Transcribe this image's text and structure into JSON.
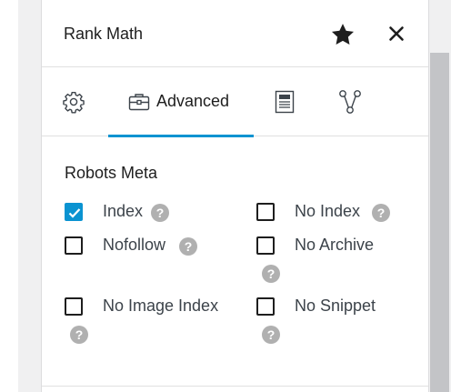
{
  "panel": {
    "title": "Rank Math"
  },
  "header_icons": {
    "favorite": "star-icon",
    "close": "close-icon"
  },
  "tabs": [
    {
      "id": "general",
      "icon": "gear-icon",
      "label": ""
    },
    {
      "id": "advanced",
      "icon": "toolbox-icon",
      "label": "Advanced",
      "active": true
    },
    {
      "id": "schema",
      "icon": "document-icon",
      "label": ""
    },
    {
      "id": "social",
      "icon": "share-icon",
      "label": ""
    }
  ],
  "robots_meta": {
    "title": "Robots Meta",
    "help_glyph": "?",
    "options": [
      {
        "label": "Index",
        "checked": true
      },
      {
        "label": "No Index",
        "checked": false
      },
      {
        "label": "Nofollow",
        "checked": false
      },
      {
        "label": "No Archive",
        "checked": false
      },
      {
        "label": "No Image Index",
        "checked": false
      },
      {
        "label": "No Snippet",
        "checked": false
      }
    ]
  },
  "colors": {
    "accent": "#0a93d1",
    "help_badge": "#b0b0b0",
    "scrollbar_thumb": "#c3c4c7"
  }
}
